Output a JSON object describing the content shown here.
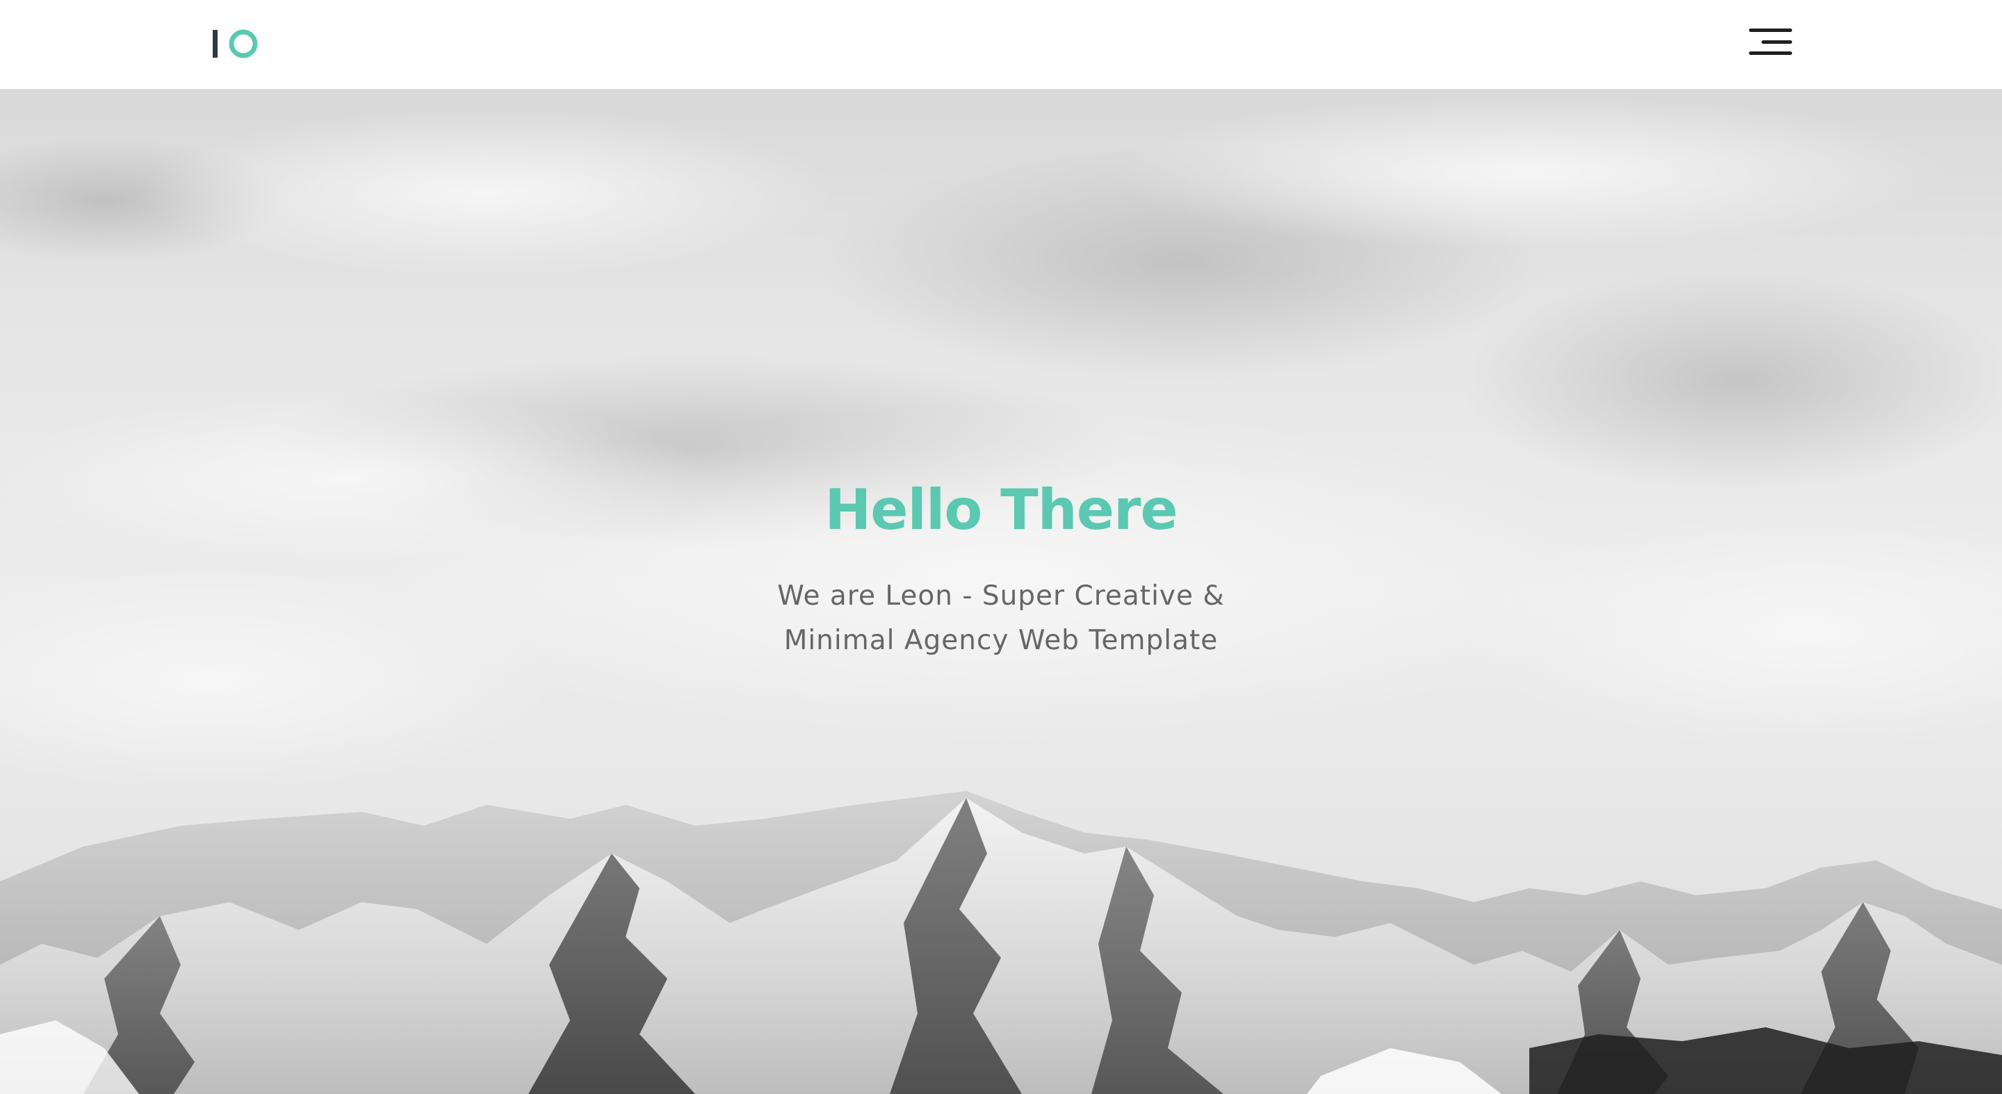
{
  "header": {
    "logo_alt": "Leon logo",
    "menu_label": "Open menu"
  },
  "hero": {
    "title": "Hello There",
    "subtitle_line1": "We are Leon - Super Creative &",
    "subtitle_line2": "Minimal Agency Web Template"
  },
  "colors": {
    "accent": "#5bc8b2",
    "dark": "#2d3a40",
    "subtitle": "#666666",
    "header_bg": "#ffffff"
  },
  "icons": {
    "logo": "leon-logo-icon",
    "menu": "hamburger-menu-icon"
  }
}
